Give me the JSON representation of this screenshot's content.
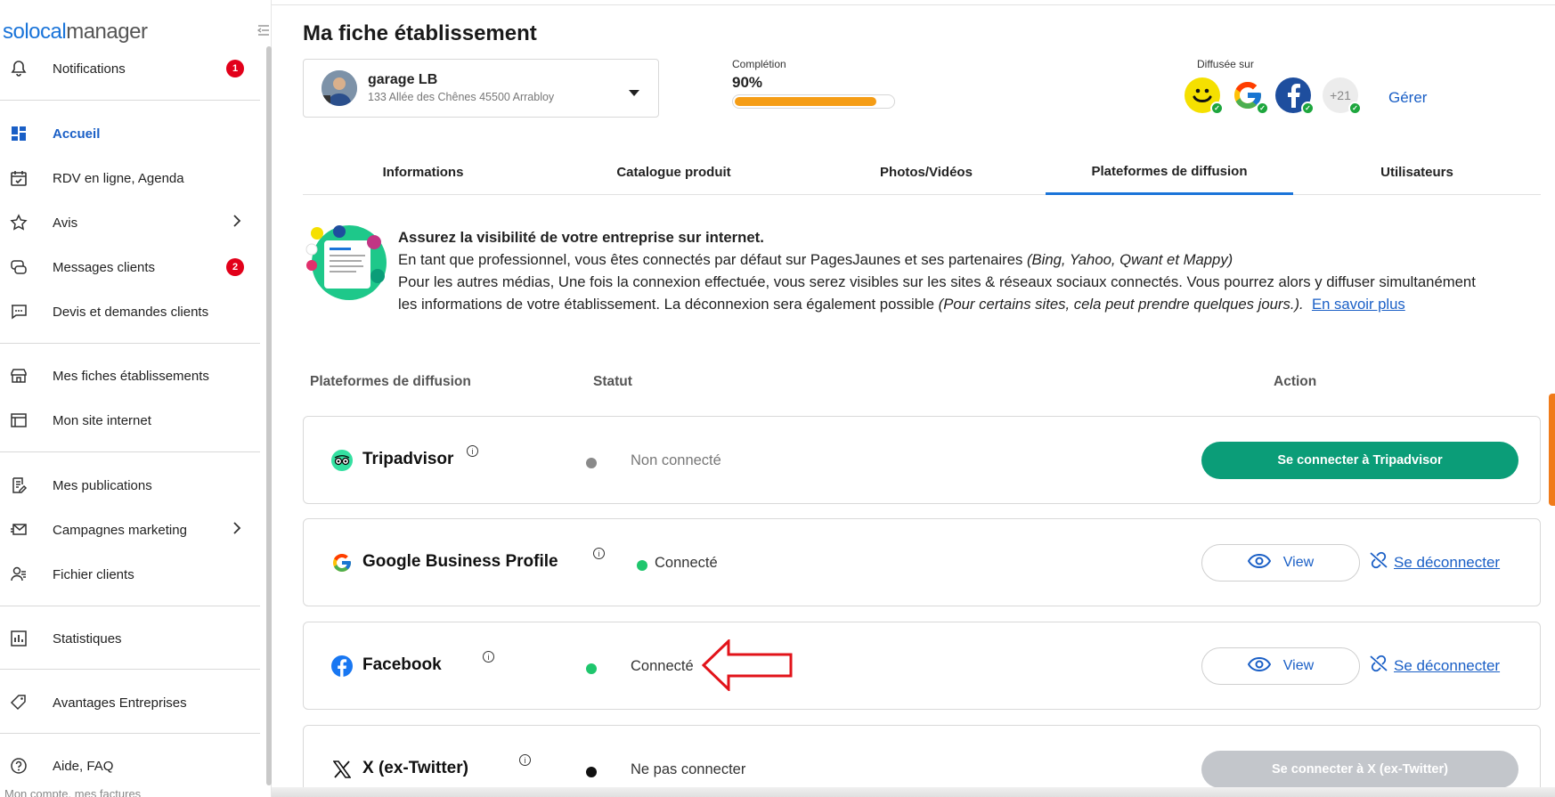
{
  "sidebar": {
    "logo_part1": "solocal",
    "logo_part2": "manager",
    "items": [
      {
        "label": "Notifications",
        "badge": "1",
        "icon": "bell-icon"
      },
      {
        "label": "Accueil",
        "active": true,
        "icon": "dashboard-icon"
      },
      {
        "label": "RDV en ligne, Agenda",
        "icon": "calendar-icon"
      },
      {
        "label": "Avis",
        "icon": "star-icon"
      },
      {
        "label": "Messages clients",
        "badge": "2",
        "icon": "messages-icon"
      },
      {
        "label": "Devis et demandes clients",
        "icon": "chat-icon"
      },
      {
        "label": "Mes fiches établissements",
        "icon": "store-icon"
      },
      {
        "label": "Mon site internet",
        "icon": "website-icon"
      },
      {
        "label": "Mes publications",
        "icon": "edit-document-icon"
      },
      {
        "label": "Campagnes marketing",
        "icon": "mail-send-icon"
      },
      {
        "label": "Fichier clients",
        "icon": "users-icon"
      },
      {
        "label": "Statistiques",
        "icon": "chart-icon"
      },
      {
        "label": "Avantages Entreprises",
        "icon": "tag-icon"
      },
      {
        "label": "Aide, FAQ",
        "icon": "help-icon"
      }
    ],
    "footer_cut": "Mon compte, mes factures"
  },
  "header": {
    "title": "Ma fiche établissement",
    "business": {
      "name": "garage LB",
      "address": "133 Allée des Chênes 45500 Arrabloy"
    },
    "completion": {
      "caption": "Complétion",
      "value_text": "90%",
      "fraction": 0.9
    },
    "diffused": {
      "caption": "Diffusée sur",
      "more": "+21",
      "manage": "Gérer"
    }
  },
  "tabs": [
    "Informations",
    "Catalogue produit",
    "Photos/Vidéos",
    "Plateformes de diffusion",
    "Utilisateurs"
  ],
  "info": {
    "headline": "Assurez la visibilité de votre entreprise sur internet.",
    "line1": "En tant que professionnel, vous êtes connectés par défaut sur PagesJaunes et ses partenaires ",
    "line1_it": "(Bing, Yahoo, Qwant et Mappy)",
    "line2": "Pour les autres médias, Une fois la connexion effectuée, vous serez visibles sur les sites & réseaux sociaux connectés. Vous pourrez alors y diffuser simultanément les informations de votre établissement. La déconnexion sera également possible ",
    "line2_it": "(Pour certains sites, cela peut prendre quelques jours.).",
    "learn_more": "En savoir plus"
  },
  "table": {
    "col_platform": "Plateformes de diffusion",
    "col_status": "Statut",
    "col_action": "Action",
    "rows": [
      {
        "name": "Tripadvisor",
        "status": "Non connecté",
        "action": "Se connecter à Tripadvisor"
      },
      {
        "name": "Google Business Profile",
        "status": "Connecté",
        "view": "View",
        "disconnect": "Se déconnecter"
      },
      {
        "name": "Facebook",
        "status": "Connecté",
        "view": "View",
        "disconnect": "Se déconnecter"
      },
      {
        "name": "X (ex-Twitter)",
        "status": "Ne pas connecter",
        "action": "Se connecter à X (ex-Twitter)"
      }
    ]
  },
  "colors": {
    "accent": "#1a74d9",
    "green": "#0b9d78",
    "orange": "#f59d16",
    "badge": "#e2001a"
  }
}
